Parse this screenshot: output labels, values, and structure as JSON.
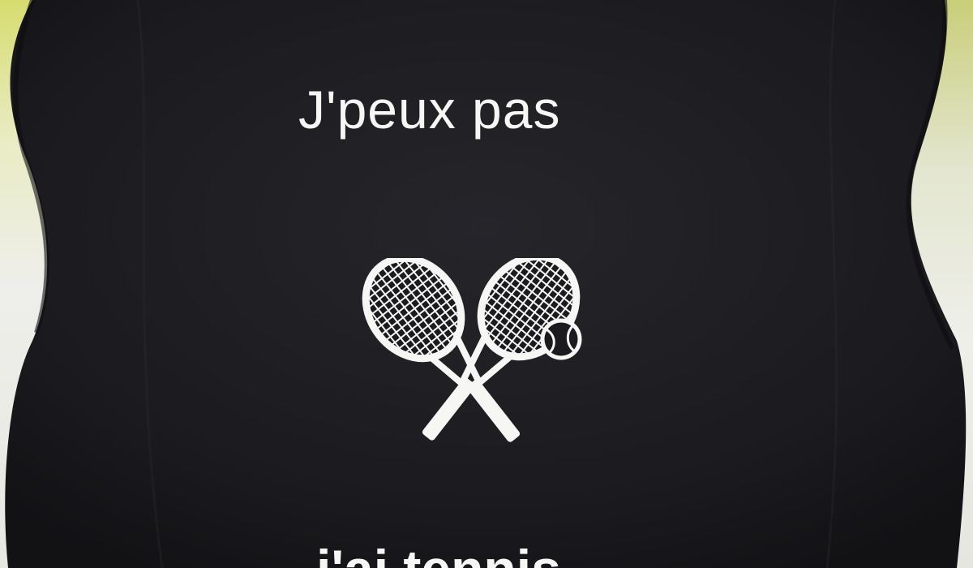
{
  "shirt_print": {
    "top_line": "J'peux pas",
    "bottom_line": "j'ai tennis"
  },
  "graphic": {
    "icon": "crossed-tennis-rackets-icon",
    "ball_icon": "tennis-ball-icon"
  },
  "colors": {
    "shirt": "#1b1b1f",
    "print": "#f6f6f4",
    "wall": "#eeeeea",
    "wall_tint": "#d7dc6f"
  }
}
